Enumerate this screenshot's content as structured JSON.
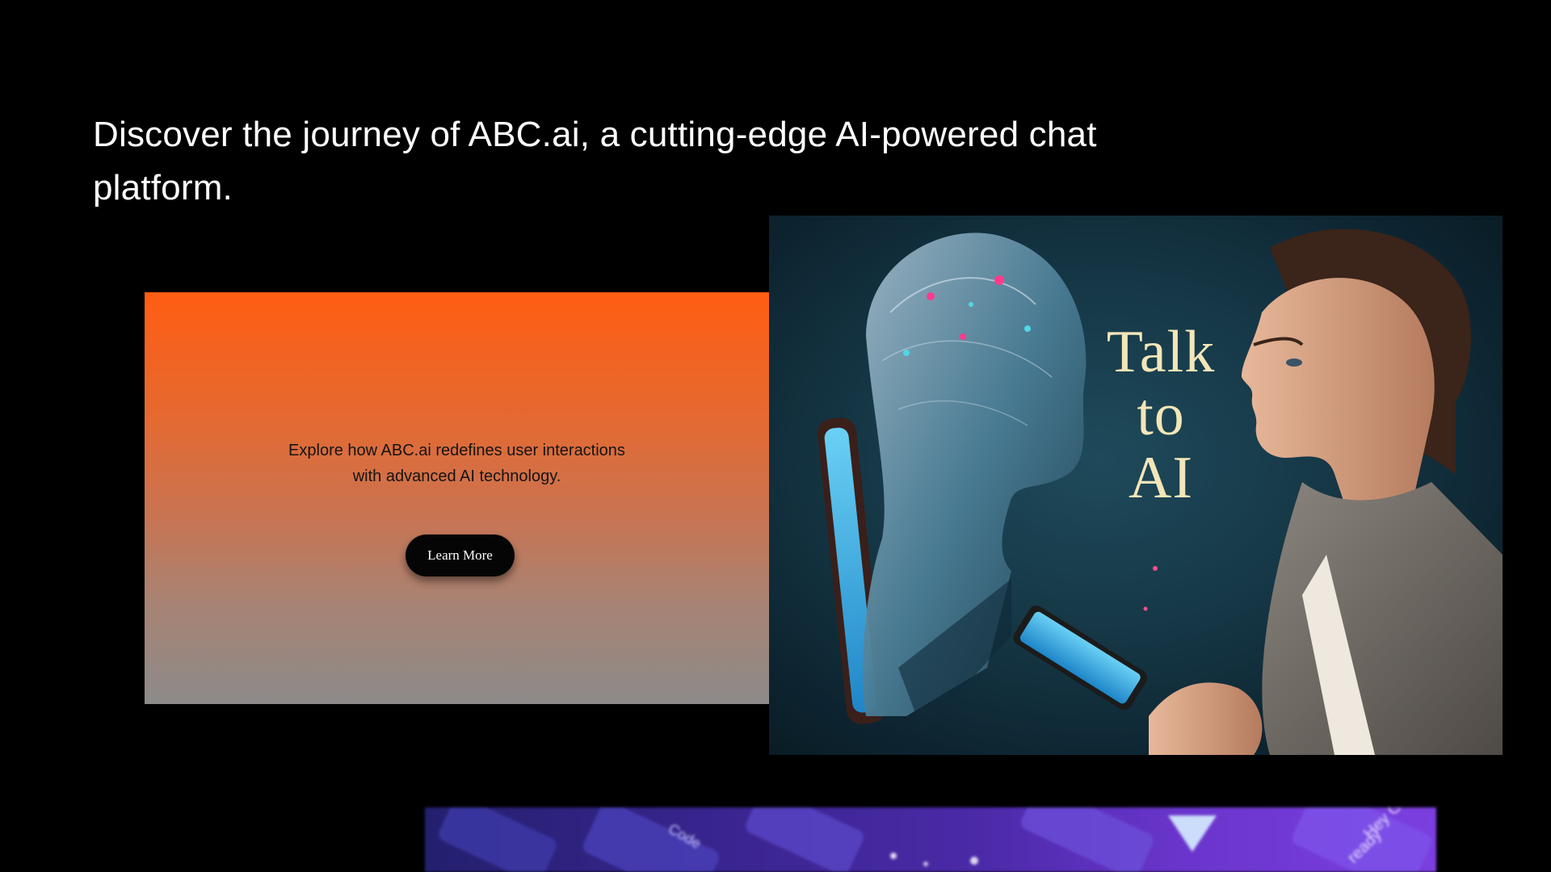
{
  "hero": {
    "headline": "Discover the journey of ABC.ai, a cutting-edge AI-powered chat platform."
  },
  "promo": {
    "description_line1": "Explore how ABC.ai redefines user interactions",
    "description_line2": "with advanced AI technology.",
    "button_label": "Learn More"
  },
  "image": {
    "caption_line1": "Talk",
    "caption_line2": "to",
    "caption_line3": "AI"
  },
  "strip": {
    "label1": "Code",
    "label2": "Hey Ge",
    "label3": "ready"
  },
  "colors": {
    "background": "#000000",
    "promo_gradient_top": "#ff5d13",
    "promo_gradient_bottom": "#8c8a8a",
    "button_bg": "#050505",
    "caption": "#f3e6b8"
  }
}
